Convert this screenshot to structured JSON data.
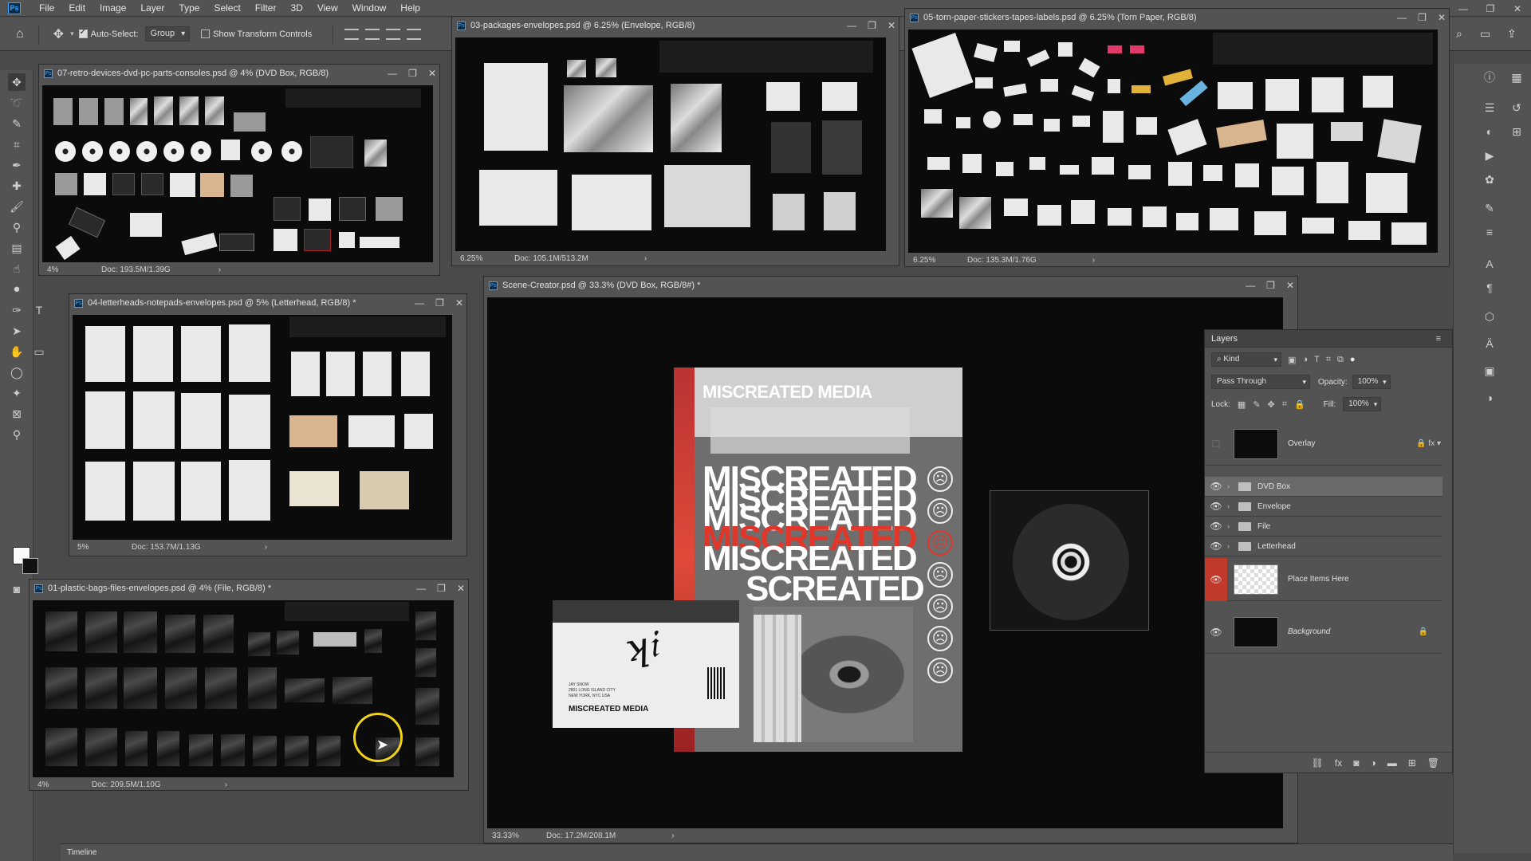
{
  "app": {
    "logo": "Ps"
  },
  "menu": [
    "File",
    "Edit",
    "Image",
    "Layer",
    "Type",
    "Select",
    "Filter",
    "3D",
    "View",
    "Window",
    "Help"
  ],
  "options": {
    "auto_select_label": "Auto-Select:",
    "auto_select_value": "Group",
    "show_transform_label": "Show Transform Controls"
  },
  "docs": {
    "retro": {
      "title": "07-retro-devices-dvd-pc-parts-consoles.psd @ 4% (DVD Box, RGB/8)",
      "zoom": "4%",
      "size": "Doc: 193.5M/1.39G"
    },
    "packages": {
      "title": "03-packages-envelopes.psd @ 6.25% (Envelope, RGB/8)",
      "zoom": "6.25%",
      "size": "Doc: 105.1M/513.2M"
    },
    "paper": {
      "title": "05-torn-paper-stickers-tapes-labels.psd @ 6.25% (Torn Paper, RGB/8)",
      "zoom": "6.25%",
      "size": "Doc: 135.3M/1.76G"
    },
    "letterheads": {
      "title": "04-letterheads-notepads-envelopes.psd @ 5% (Letterhead, RGB/8) *",
      "zoom": "5%",
      "size": "Doc: 153.7M/1.13G"
    },
    "plastic": {
      "title": "01-plastic-bags-files-envelopes.psd @ 4% (File, RGB/8) *",
      "zoom": "4%",
      "size": "Doc: 209.5M/1.10G"
    },
    "scene": {
      "title": "Scene-Creator.psd @ 33.3% (DVD Box, RGB/8#) *",
      "zoom": "33.33%",
      "size": "Doc: 17.2M/208.1M"
    }
  },
  "artwork": {
    "header": "MISCREATED MEDIA",
    "word": "MISCREATED",
    "word2": "SCREATED",
    "envelope_label": "MISCREATED MEDIA",
    "envelope_address": "JAY SNOW\n2801 LONG ISLAND CITY\nNEW YORK, NYC USA"
  },
  "layers_panel": {
    "title": "Layers",
    "filter": "Kind",
    "blend_mode": "Pass Through",
    "opacity_label": "Opacity:",
    "opacity_value": "100%",
    "lock_label": "Lock:",
    "fill_label": "Fill:",
    "fill_value": "100%",
    "layers": [
      {
        "name": "Overlay",
        "type": "layer"
      },
      {
        "name": "DVD Box",
        "type": "group",
        "selected": true
      },
      {
        "name": "Envelope",
        "type": "group"
      },
      {
        "name": "File",
        "type": "group"
      },
      {
        "name": "Letterhead",
        "type": "group"
      },
      {
        "name": "Place Items Here",
        "type": "layer"
      },
      {
        "name": "Background",
        "type": "layer",
        "locked": true
      }
    ]
  },
  "timeline": {
    "label": "Timeline"
  },
  "colors": {
    "accent": "#31a8ff",
    "red": "#e0372a",
    "panel": "#535353",
    "workspace": "#4a4a4a",
    "highlight_ring": "#f1d21a"
  }
}
